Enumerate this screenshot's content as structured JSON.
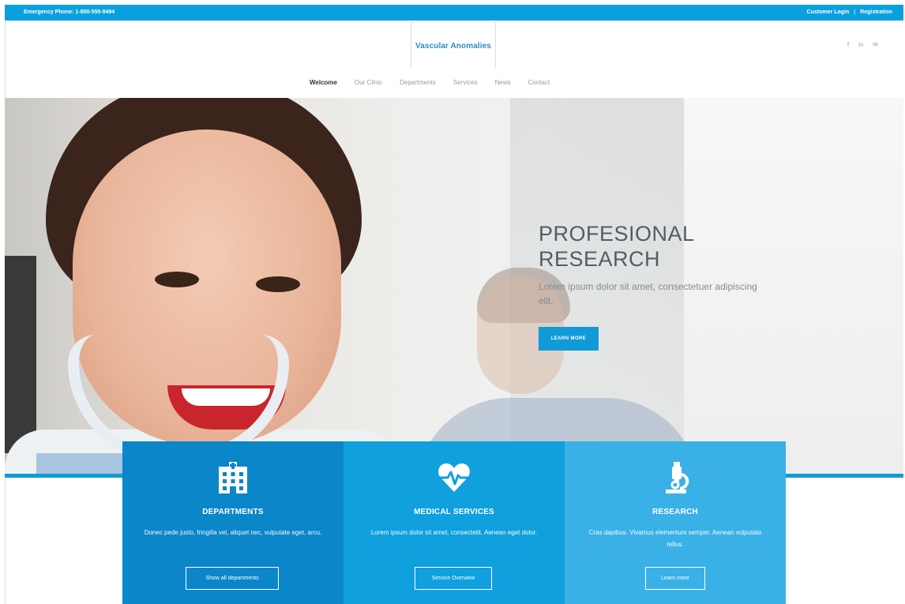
{
  "topbar": {
    "phone": "Emergency Phone: 1-800-555-9494",
    "customer_login": "Customer Login",
    "registration": "Registration"
  },
  "header": {
    "logo": "Vascular Anomalies",
    "social": [
      "f",
      "in",
      "✉"
    ]
  },
  "nav": {
    "items": [
      "Welcome",
      "Our Clinic",
      "Departments",
      "Services",
      "News",
      "Contact"
    ]
  },
  "hero": {
    "title_line1": "PROFESIONAL",
    "title_line2": "RESEARCH",
    "subtitle": "Lorem ipsum dolor sit amet, consectetuer adipiscing elit.",
    "button": "LEARN MORE"
  },
  "panels": [
    {
      "icon": "hospital-icon",
      "title": "DEPARTMENTS",
      "text": "Donec pede justo, fringilla vel, aliquet nec, vulputate eget, arcu.",
      "button": "Show all departments"
    },
    {
      "icon": "heart-pulse-icon",
      "title": "MEDICAL SERVICES",
      "text": "Lorem ipsum dolor sit amet, consectetit. Aenean eget dolor.",
      "button": "Service Overview"
    },
    {
      "icon": "microscope-icon",
      "title": "RESEARCH",
      "text": "Cras dapibus. Vivamus elementum semper. Aenean vulputate tellus.",
      "button": "Learn more"
    }
  ],
  "colors": {
    "accent": "#0aa0df",
    "panel1": "#0a86c9",
    "panel2": "#0fa0dd",
    "panel3": "#39b1e6"
  }
}
